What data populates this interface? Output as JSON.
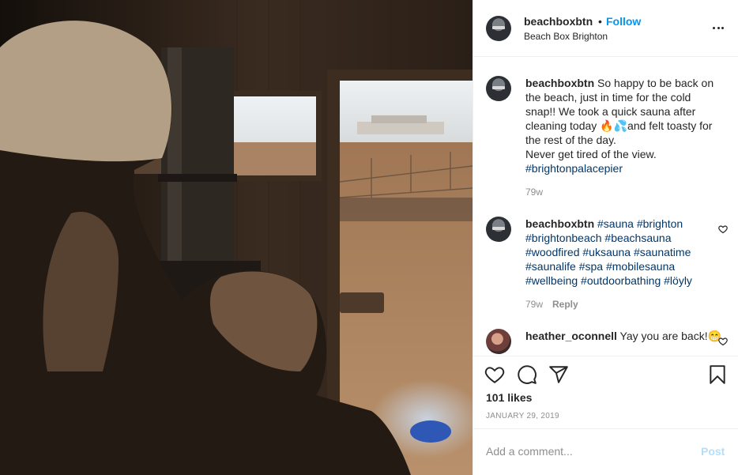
{
  "post": {
    "username": "beachboxbtn",
    "follow_separator": "•",
    "follow_label": "Follow",
    "location": "Beach Box Brighton",
    "more_icon": "more-horizontal-icon"
  },
  "comments": [
    {
      "username": "beachboxbtn",
      "text": " So happy to be back on the beach, just in time for the cold snap!! We took a quick sauna after cleaning today 🔥💦and felt toasty for the rest of the day.\nNever get tired of the view.\n",
      "hashtags": "#brightonpalacepier",
      "time": "79w"
    },
    {
      "username": "beachboxbtn",
      "text": " ",
      "hashtags": "#sauna #brighton #brightonbeach #beachsauna #woodfired #uksauna #saunatime #saunalife #spa #mobilesauna #wellbeing #outdoorbathing #löyly",
      "time": "79w",
      "reply_label": "Reply"
    },
    {
      "username": "heather_oconnell",
      "text": " Yay you are back!😁",
      "hashtags": ""
    }
  ],
  "actions": {
    "icons": [
      "heart-icon",
      "comment-icon",
      "share-icon",
      "bookmark-icon"
    ],
    "likes": "101 likes",
    "date": "JANUARY 29, 2019"
  },
  "add_comment": {
    "placeholder": "Add a comment...",
    "post_label": "Post"
  },
  "colors": {
    "link_blue": "#0095f6",
    "hashtag": "#00376b",
    "secondary_text": "#8e8e8e",
    "post_disabled": "#b2dffc"
  }
}
